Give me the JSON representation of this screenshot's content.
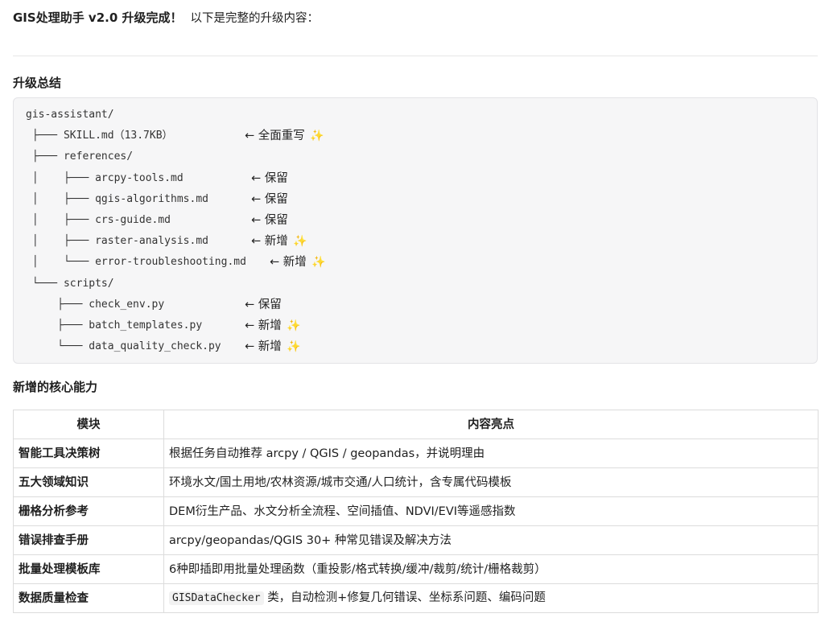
{
  "intro": {
    "title": "GIS处理助手 v2.0 升级完成！",
    "subtitle": "以下是完整的升级内容："
  },
  "upgrade_summary": {
    "heading": "升级总结",
    "tree": [
      {
        "text": "gis-assistant/",
        "note": "",
        "sparkle": false
      },
      {
        "text": " ├─── SKILL.md（13.7KB）",
        "note": "← 全面重写",
        "sparkle": true
      },
      {
        "text": " ├─── references/",
        "note": "",
        "sparkle": false
      },
      {
        "text": " │    ├─── arcpy-tools.md",
        "note": "← 保留",
        "sparkle": false
      },
      {
        "text": " │    ├─── qgis-algorithms.md",
        "note": "← 保留",
        "sparkle": false
      },
      {
        "text": " │    ├─── crs-guide.md",
        "note": "← 保留",
        "sparkle": false
      },
      {
        "text": " │    ├─── raster-analysis.md",
        "note": "← 新增",
        "sparkle": true
      },
      {
        "text": " │    └─── error-troubleshooting.md",
        "note": "← 新增",
        "sparkle": true
      },
      {
        "text": " └─── scripts/",
        "note": "",
        "sparkle": false
      },
      {
        "text": "     ├─── check_env.py",
        "note": "← 保留",
        "sparkle": false
      },
      {
        "text": "     ├─── batch_templates.py",
        "note": "← 新增",
        "sparkle": true
      },
      {
        "text": "     └─── data_quality_check.py",
        "note": "← 新增",
        "sparkle": true
      }
    ],
    "sparkle_symbol": "✨"
  },
  "capabilities": {
    "heading": "新增的核心能力",
    "columns": [
      "模块",
      "内容亮点"
    ],
    "rows": [
      {
        "module": "智能工具决策树",
        "highlight": "根据任务自动推荐 arcpy / QGIS / geopandas，并说明理由"
      },
      {
        "module": "五大领域知识",
        "highlight": "环境水文/国土用地/农林资源/城市交通/人口统计，含专属代码模板"
      },
      {
        "module": "栅格分析参考",
        "highlight": "DEM衍生产品、水文分析全流程、空间插值、NDVI/EVI等遥感指数"
      },
      {
        "module": "错误排查手册",
        "highlight": "arcpy/geopandas/QGIS 30+ 种常见错误及解决方法"
      },
      {
        "module": "批量处理模板库",
        "highlight": "6种即插即用批量处理函数（重投影/格式转换/缓冲/裁剪/统计/栅格裁剪）"
      },
      {
        "module": "数据质量检查",
        "highlight_code": "GISDataChecker",
        "highlight": "类，自动检测+修复几何错误、坐标系问题、编码问题"
      }
    ]
  }
}
